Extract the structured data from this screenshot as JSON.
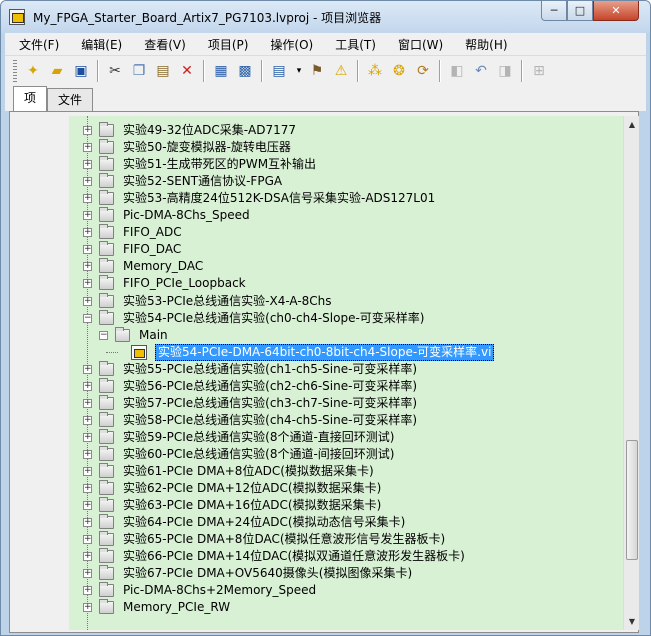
{
  "window": {
    "title": "My_FPGA_Starter_Board_Artix7_PG7103.lvproj - 项目浏览器",
    "minimize": "─",
    "maximize": "□",
    "close": "✕"
  },
  "menu": [
    "文件(F)",
    "编辑(E)",
    "查看(V)",
    "项目(P)",
    "操作(O)",
    "工具(T)",
    "窗口(W)",
    "帮助(H)"
  ],
  "toolbar": {
    "icons": [
      "new-icon",
      "open-icon",
      "save-all-icon",
      "cut-icon",
      "copy-icon",
      "paste-icon",
      "delete-icon",
      "properties-icon",
      "save-icon",
      "view-icon",
      "build-icon",
      "warning-icon",
      "add-icon",
      "resolve-icon",
      "refresh-icon",
      "back-icon",
      "undo-icon",
      "forward-icon",
      "expand-icon"
    ]
  },
  "tabs": [
    {
      "label": "项",
      "active": true
    },
    {
      "label": "文件",
      "active": false
    }
  ],
  "tree": {
    "items": [
      {
        "label": "实验49-32位ADC采集-AD7177",
        "type": "folder",
        "level": 1
      },
      {
        "label": "实验50-旋变模拟器-旋转电压器",
        "type": "folder",
        "level": 1
      },
      {
        "label": "实验51-生成带死区的PWM互补输出",
        "type": "folder",
        "level": 1
      },
      {
        "label": "实验52-SENT通信协议-FPGA",
        "type": "folder",
        "level": 1
      },
      {
        "label": "实验53-高精度24位512K-DSA信号采集实验-ADS127L01",
        "type": "folder",
        "level": 1
      },
      {
        "label": "Pic-DMA-8Chs_Speed",
        "type": "folder",
        "level": 1
      },
      {
        "label": "FIFO_ADC",
        "type": "folder",
        "level": 1
      },
      {
        "label": "FIFO_DAC",
        "type": "folder",
        "level": 1
      },
      {
        "label": "Memory_DAC",
        "type": "folder",
        "level": 1
      },
      {
        "label": "FIFO_PCIe_Loopback",
        "type": "folder",
        "level": 1
      },
      {
        "label": "实验53-PCIe总线通信实验-X4-A-8Chs",
        "type": "folder",
        "level": 1
      },
      {
        "label": "实验54-PCIe总线通信实验(ch0-ch4-Slope-可变采样率)",
        "type": "folder-open",
        "level": 1
      },
      {
        "label": "Main",
        "type": "folder-open",
        "level": 2
      },
      {
        "label": "实验54-PCIe-DMA-64bit-ch0-8bit-ch4-Slope-可变采样率.vi",
        "type": "vi",
        "level": 3,
        "selected": true
      },
      {
        "label": "实验55-PCIe总线通信实验(ch1-ch5-Sine-可变采样率)",
        "type": "folder",
        "level": 1
      },
      {
        "label": "实验56-PCIe总线通信实验(ch2-ch6-Sine-可变采样率)",
        "type": "folder",
        "level": 1
      },
      {
        "label": "实验57-PCIe总线通信实验(ch3-ch7-Sine-可变采样率)",
        "type": "folder",
        "level": 1
      },
      {
        "label": "实验58-PCIe总线通信实验(ch4-ch5-Sine-可变采样率)",
        "type": "folder",
        "level": 1
      },
      {
        "label": "实验59-PCIe总线通信实验(8个通道-直接回环测试)",
        "type": "folder",
        "level": 1
      },
      {
        "label": "实验60-PCIe总线通信实验(8个通道-间接回环测试)",
        "type": "folder",
        "level": 1
      },
      {
        "label": "实验61-PCIe DMA+8位ADC(模拟数据采集卡)",
        "type": "folder",
        "level": 1
      },
      {
        "label": "实验62-PCIe DMA+12位ADC(模拟数据采集卡)",
        "type": "folder",
        "level": 1
      },
      {
        "label": "实验63-PCIe DMA+16位ADC(模拟数据采集卡)",
        "type": "folder",
        "level": 1
      },
      {
        "label": "实验64-PCIe DMA+24位ADC(模拟动态信号采集卡)",
        "type": "folder",
        "level": 1
      },
      {
        "label": "实验65-PCIe DMA+8位DAC(模拟任意波形信号发生器板卡)",
        "type": "folder",
        "level": 1
      },
      {
        "label": "实验66-PCIe DMA+14位DAC(模拟双通道任意波形发生器板卡)",
        "type": "folder",
        "level": 1
      },
      {
        "label": "实验67-PCIe DMA+OV5640摄像头(模拟图像采集卡)",
        "type": "folder",
        "level": 1
      },
      {
        "label": "Pic-DMA-8Chs+2Memory_Speed",
        "type": "folder",
        "level": 1
      },
      {
        "label": "Memory_PCIe_RW",
        "type": "folder",
        "level": 1
      }
    ]
  }
}
